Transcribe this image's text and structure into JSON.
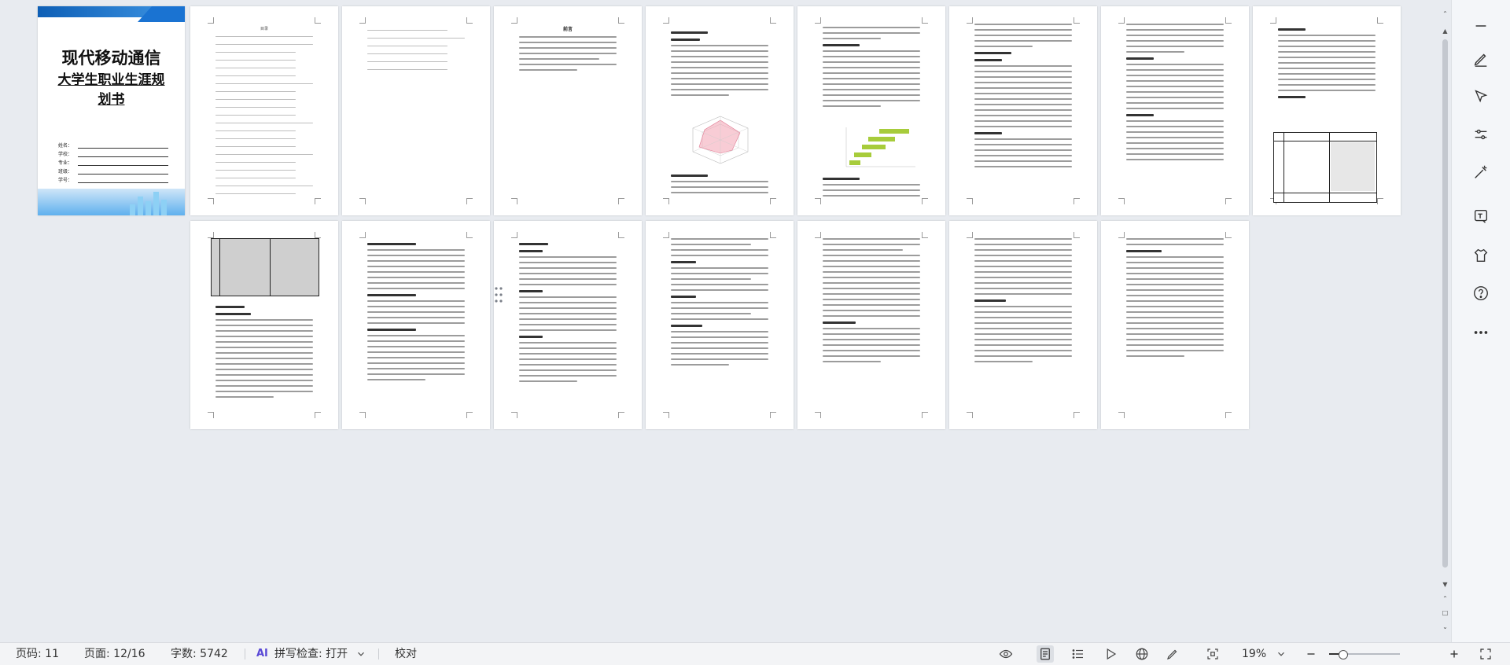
{
  "document": {
    "cover_title": "现代移动通信",
    "cover_subtitle": "大学生职业生涯规划书",
    "cover_fields": [
      "姓名：",
      "学校：",
      "专业：",
      "班级：",
      "学号："
    ],
    "toc_heading": "目录",
    "preface_heading": "前言",
    "page_count_visible": 16
  },
  "status": {
    "page_code": "页码: 11",
    "page_info": "页面: 12/16",
    "word_count": "字数: 5742",
    "spellcheck": "拼写检查: 打开",
    "proofread": "校对",
    "zoom_level": "19%",
    "zoom_fraction": 0.19
  },
  "icons": {
    "ai": "AI",
    "spellcheck_chevron": "chevron-down-icon"
  },
  "colors": {
    "accent": "#1a73d2",
    "chart_green": "#a7cc3b",
    "chart_pink": "#f2a3b3"
  }
}
